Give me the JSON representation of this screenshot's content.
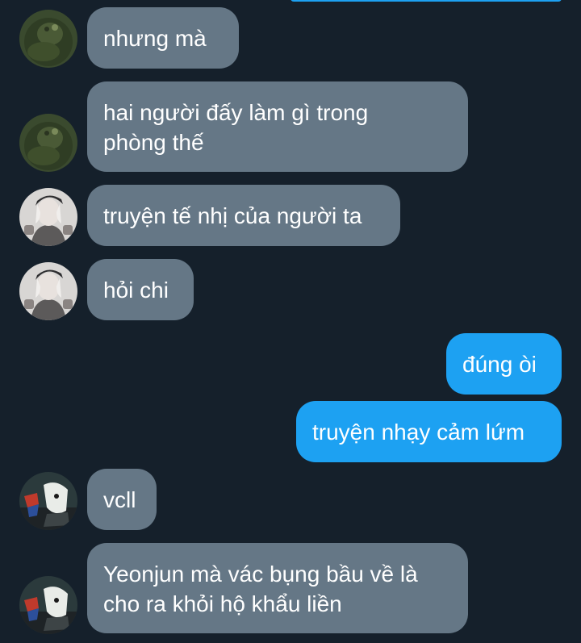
{
  "conversation": {
    "messages": [
      {
        "sender": "them",
        "lines": [
          "nhưng mà"
        ]
      },
      {
        "sender": "them",
        "lines": [
          "hai người đấy làm gì trong",
          "phòng thế"
        ]
      },
      {
        "sender": "them",
        "lines": [
          "truyện tế nhị của người ta"
        ]
      },
      {
        "sender": "them",
        "lines": [
          "hỏi chi"
        ]
      },
      {
        "sender": "me",
        "lines": [
          "đúng òi"
        ]
      },
      {
        "sender": "me",
        "lines": [
          "truyện nhạy cảm lứm"
        ]
      },
      {
        "sender": "them",
        "lines": [
          "vcll"
        ]
      },
      {
        "sender": "them",
        "lines": [
          "Yeonjun mà vác bụng bầu về là",
          "cho ra khỏi hộ khẩu liền"
        ]
      }
    ]
  },
  "colors": {
    "background": "#15202b",
    "incoming_bubble": "#657786",
    "outgoing_bubble": "#1da1f2",
    "text": "#ffffff"
  }
}
